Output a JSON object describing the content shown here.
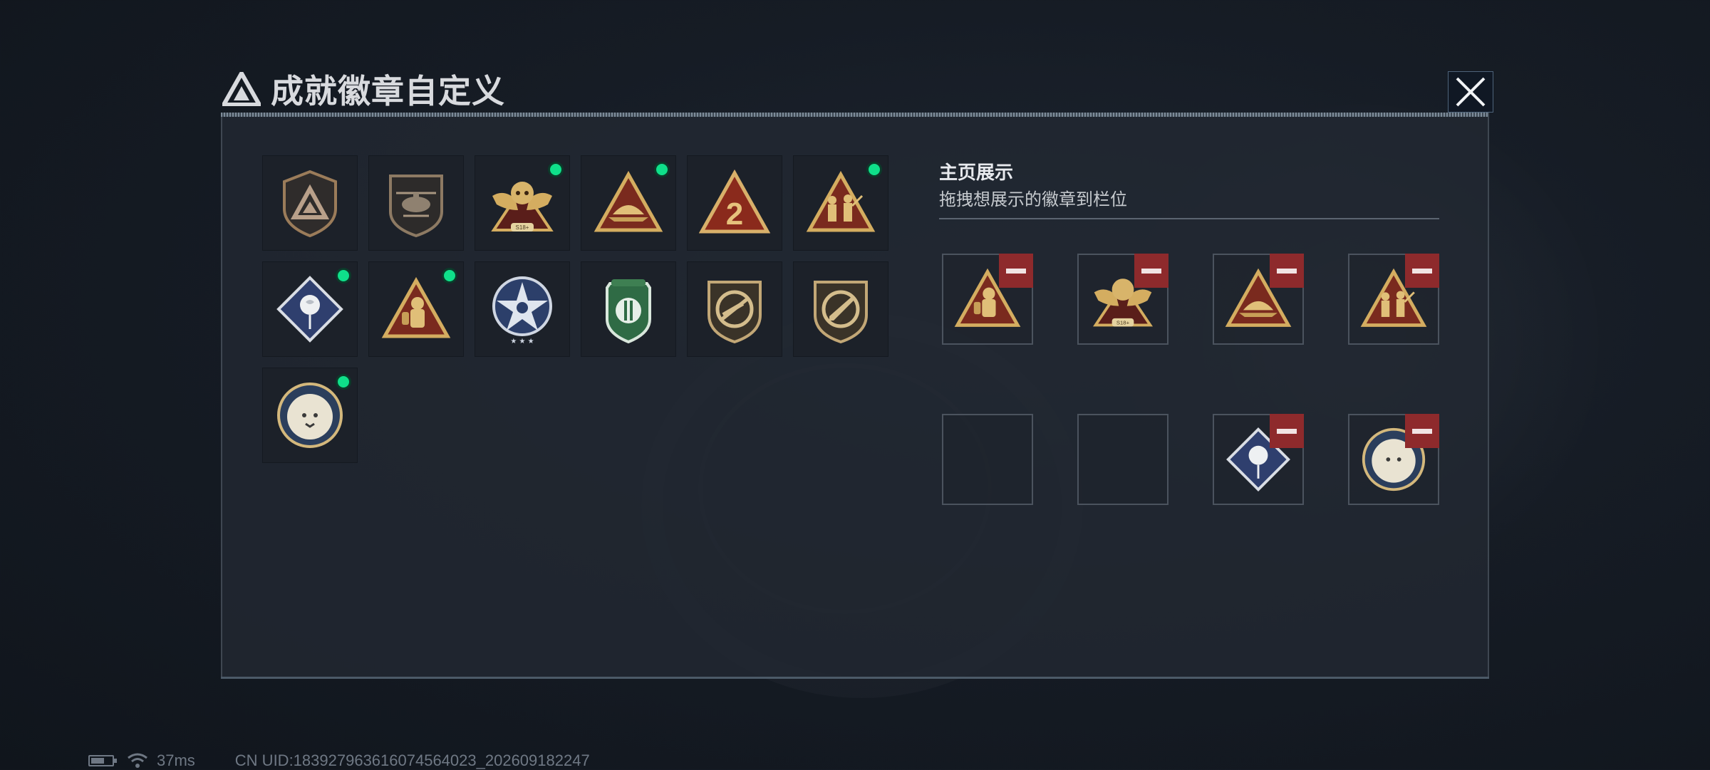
{
  "header": {
    "title": "成就徽章自定义"
  },
  "collection": {
    "badges": [
      {
        "icon": "triangle-emblem-shield-icon",
        "is_new": false
      },
      {
        "icon": "helicopter-shield-icon",
        "is_new": false
      },
      {
        "icon": "eagle-skull-icon",
        "label": "S18+",
        "is_new": true
      },
      {
        "icon": "helmet-triangle-icon",
        "is_new": true
      },
      {
        "icon": "number-2-triangle-icon",
        "label": "2",
        "is_new": false
      },
      {
        "icon": "soldiers-triangle-icon",
        "is_new": true
      },
      {
        "icon": "rose-diamond-icon",
        "is_new": true
      },
      {
        "icon": "hazmat-soldier-triangle-icon",
        "is_new": true
      },
      {
        "icon": "star-compass-shield-icon",
        "is_new": false
      },
      {
        "icon": "green-army-shield-icon",
        "is_new": false
      },
      {
        "icon": "no-rifle-shield-icon",
        "is_new": false
      },
      {
        "icon": "knife-shield-icon",
        "is_new": false
      },
      {
        "icon": "lynx-medallion-icon",
        "is_new": true
      }
    ]
  },
  "showcase": {
    "title": "主页展示",
    "subtitle": "拖拽想展示的徽章到栏位",
    "slots": [
      {
        "icon": "hazmat-soldier-triangle-icon",
        "filled": true
      },
      {
        "icon": "eagle-skull-icon",
        "filled": true
      },
      {
        "icon": "helmet-triangle-icon",
        "filled": true
      },
      {
        "icon": "soldiers-triangle-icon",
        "filled": true
      },
      {
        "icon": "",
        "filled": false
      },
      {
        "icon": "",
        "filled": false
      },
      {
        "icon": "rose-diamond-icon",
        "filled": true
      },
      {
        "icon": "lynx-medallion-icon",
        "filled": true
      }
    ]
  },
  "status": {
    "ping": "37ms",
    "uid": "CN UID:18392796361607456402​3_202609182247"
  },
  "colors": {
    "accent_new": "#0fe08a",
    "remove": "#8e2a2c",
    "gold": "#c9a25a",
    "panel": "#222832"
  }
}
